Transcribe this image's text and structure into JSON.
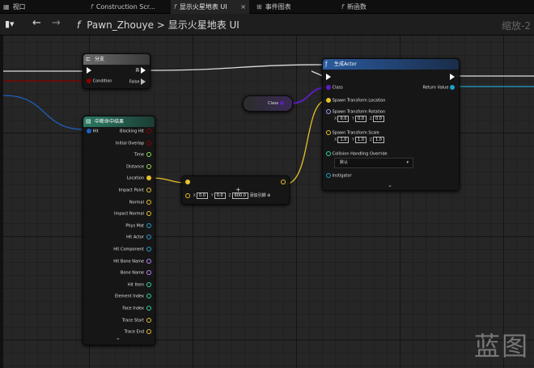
{
  "tabs": [
    {
      "label": "视口",
      "icon": "viewport-icon"
    },
    {
      "label": "Construction Scr...",
      "icon": "function-icon"
    },
    {
      "label": "显示火星地表 UI",
      "icon": "function-icon",
      "close": "×",
      "active": true
    },
    {
      "label": "事件图表",
      "icon": "event-graph-icon"
    },
    {
      "label": "新函数",
      "icon": "function-icon"
    }
  ],
  "breadcrumb": {
    "owner": "Pawn_Zhouye",
    "separator": ">",
    "current": "显示火星地表 UI"
  },
  "zoom_label": "缩放-2",
  "nodes": {
    "branch": {
      "title": "分支",
      "condition": "Condition",
      "true_label": "真",
      "false_label": "False"
    },
    "class_pin": {
      "label": "Class"
    },
    "break_hit": {
      "title": "中断命中结果",
      "input": "Hit",
      "outputs": [
        "Blocking Hit",
        "Initial Overlap",
        "Time",
        "Distance",
        "Location",
        "Impact Point",
        "Normal",
        "Impact Normal",
        "Phys Mat",
        "Hit Actor",
        "Hit Component",
        "Hit Bone Name",
        "Bone Name",
        "Hit Item",
        "Element Index",
        "Face Index",
        "Trace Start",
        "Trace End"
      ]
    },
    "add": {
      "x": "0.0",
      "y": "0.0",
      "z": "600.0",
      "add_pin": "添加引脚"
    },
    "spawn": {
      "title": "生成Actor",
      "class": "Class",
      "return_value": "Return Value",
      "spawn_location": "Spawn Transform Location",
      "spawn_rotation": "Spawn Transform Rotation",
      "rotation": {
        "x": "0.0",
        "y": "0.0",
        "z": "0.0"
      },
      "spawn_scale": "Spawn Transform Scale",
      "scale": {
        "x": "1.0",
        "y": "1.0",
        "z": "1.0"
      },
      "collision": "Collision Handling Override",
      "collision_value": "默认",
      "instigator": "Instigator"
    }
  },
  "watermark": "蓝图",
  "colors": {
    "exec": "#ffffff",
    "class": "#5a1fbf",
    "vector": "#e8c22a",
    "bool": "#8c0000",
    "float": "#8ee04f",
    "object": "#1fa0c8",
    "struct": "#1f5fbf",
    "name": "#c080ff",
    "int": "#2ed8a8",
    "spawn_header": "#1f4f8a",
    "break_header": "#1d5a4a",
    "branch_header": "#555555"
  }
}
